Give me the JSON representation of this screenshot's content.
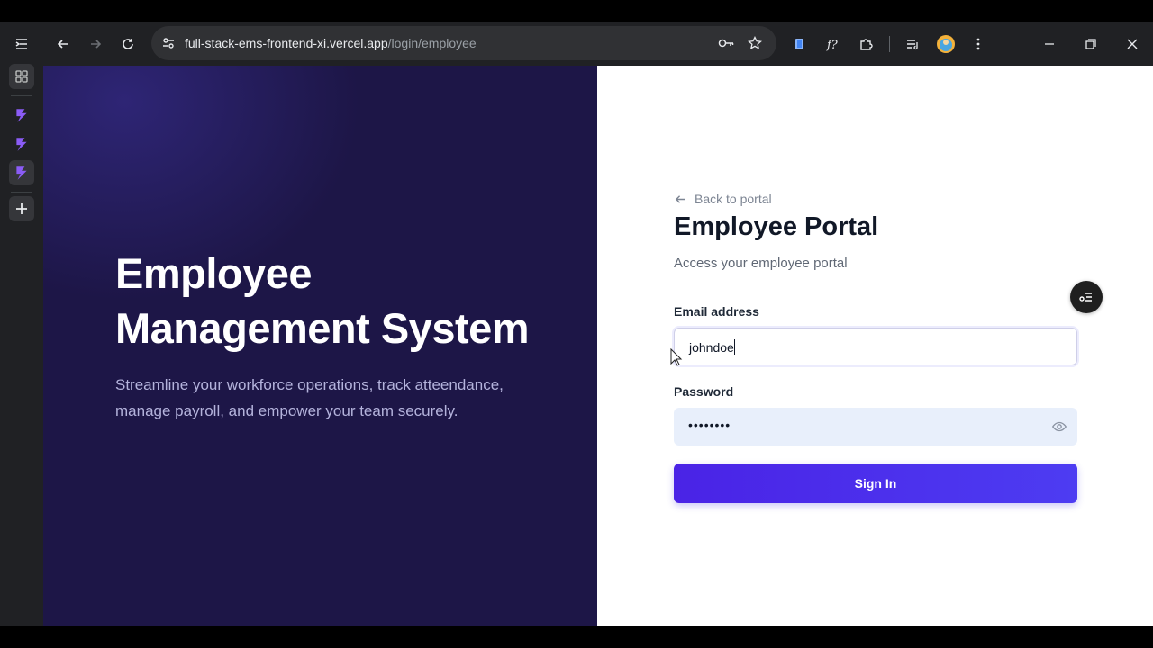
{
  "browser": {
    "url_host": "full-stack-ems-frontend-xi.vercel.app",
    "url_path": "/login/employee"
  },
  "hero": {
    "title": "Employee Management System",
    "description": "Streamline your workforce operations, track atteendance, manage payroll, and empower your team securely."
  },
  "form": {
    "back_label": "Back to portal",
    "title": "Employee Portal",
    "subtitle": "Access your employee portal",
    "email_label": "Email address",
    "email_value": "johndoe",
    "password_label": "Password",
    "password_value": "••••••••",
    "submit_label": "Sign In"
  },
  "colors": {
    "hero_bg": "#1d1647",
    "accent": "#4a23e6",
    "chrome_bg": "#202124"
  },
  "icons": {
    "side_panel": [
      "tab-groups-icon",
      "app-icon",
      "app-icon",
      "app-icon",
      "add-icon"
    ],
    "toolbar": [
      "sidebar-toggle-icon",
      "back-arrow-icon",
      "forward-arrow-icon",
      "reload-icon",
      "site-settings-icon",
      "password-key-icon",
      "bookmark-star-icon",
      "extension-icon",
      "extension-icon",
      "extensions-puzzle-icon",
      "media-queue-icon",
      "profile-avatar-icon",
      "menu-kebab-icon",
      "minimize-icon",
      "restore-icon",
      "close-icon"
    ]
  }
}
